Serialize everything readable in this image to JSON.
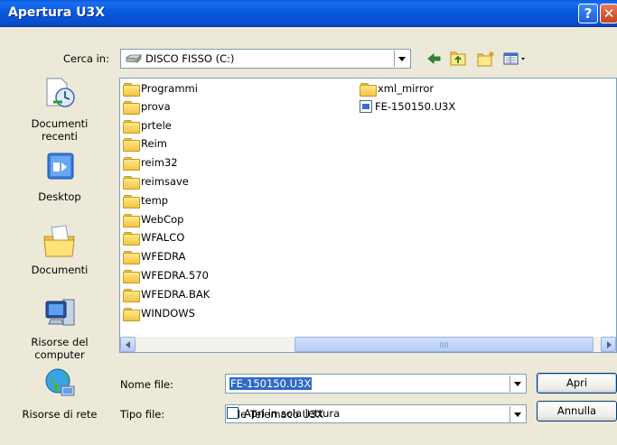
{
  "window": {
    "title": "Apertura U3X"
  },
  "lookin": {
    "label": "Cerca in:",
    "value": "DISCO FISSO (C:)"
  },
  "places": [
    {
      "label": "Documenti recenti",
      "icon": "recent-documents-icon"
    },
    {
      "label": "Desktop",
      "icon": "desktop-icon"
    },
    {
      "label": "Documenti",
      "icon": "documents-icon"
    },
    {
      "label": "Risorse del computer",
      "icon": "my-computer-icon"
    },
    {
      "label": "Risorse di rete",
      "icon": "network-icon"
    }
  ],
  "files": {
    "col1": [
      "Programmi",
      "prova",
      "prtele",
      "Reim",
      "reim32",
      "reimsave",
      "temp",
      "WebCop",
      "WFALCO",
      "WFEDRA",
      "WFEDRA.570",
      "WFEDRA.BAK",
      "WINDOWS"
    ],
    "col2": [
      {
        "name": "xml_mirror",
        "type": "folder"
      },
      {
        "name": "FE-150150.U3X",
        "type": "file"
      }
    ]
  },
  "filename": {
    "label": "Nome file:",
    "value": "FE-150150.U3X"
  },
  "filetype": {
    "label": "Tipo file:",
    "value": "File Telemaco U3X"
  },
  "buttons": {
    "open": "Apri",
    "cancel": "Annulla"
  },
  "readonly": {
    "label": "Apri in sola lettura",
    "checked": false
  },
  "colors": {
    "titlebar": "#0a5ad8",
    "selection": "#316ac5",
    "dialog_bg": "#ece9d8"
  }
}
